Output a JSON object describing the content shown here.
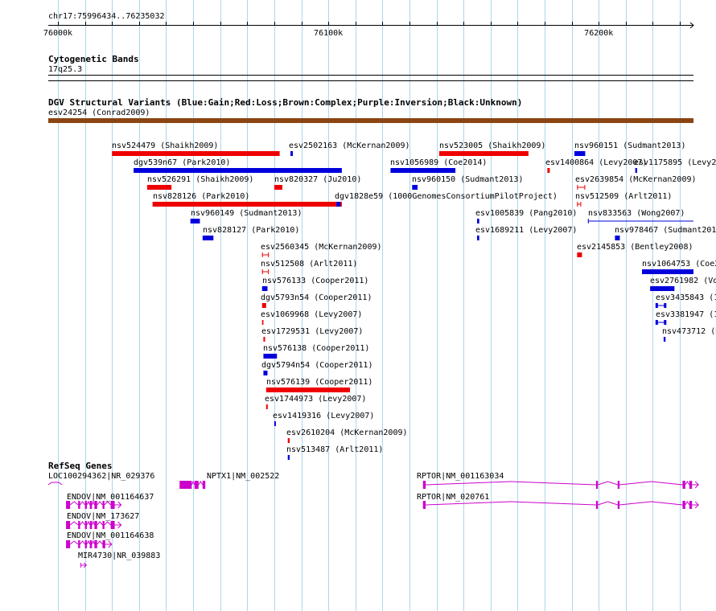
{
  "ruler": {
    "position_label": "chr17:75996434..76235032",
    "start": 75996434,
    "end": 76235032,
    "ticks": [
      {
        "label": "76000k",
        "pos": 76000000
      },
      {
        "label": "76100k",
        "pos": 76100000
      },
      {
        "label": "76200k",
        "pos": 76200000
      }
    ]
  },
  "tracks": {
    "cytoband": {
      "title": "Cytogenetic Bands",
      "band_label": "17q25.3"
    },
    "dgv": {
      "title": "DGV Structural Variants (Blue:Gain;Red:Loss;Brown:Complex;Purple:Inversion;Black:Unknown)",
      "colors": {
        "gain": "#0000dd",
        "loss": "#ee0000",
        "complex": "#8b4513",
        "inversion": "#800080",
        "unknown": "#000000"
      },
      "features": [
        {
          "label": "esv24254 (Conrad2009)",
          "type": "complex",
          "start": 75996434,
          "end": 76235032,
          "row": 0
        },
        {
          "label": "nsv524479 (Shaikh2009)",
          "type": "loss",
          "start": 76020000,
          "end": 76082000,
          "row": 1
        },
        {
          "label": "esv2502163 (McKernan2009)",
          "type": "gain",
          "start": 76086000,
          "end": 76086900,
          "row": 1
        },
        {
          "label": "nsv523005 (Shaikh2009)",
          "type": "loss",
          "start": 76141000,
          "end": 76174000,
          "row": 1
        },
        {
          "label": "nsv960151 (Sudmant2013)",
          "type": "gain",
          "start": 76191000,
          "end": 76195000,
          "row": 1
        },
        {
          "label": "dgv539n67 (Park2010)",
          "type": "gain",
          "start": 76028000,
          "end": 76105000,
          "row": 2
        },
        {
          "label": "nsv1056989 (Coe2014)",
          "type": "gain",
          "start": 76123000,
          "end": 76147000,
          "row": 2
        },
        {
          "label": "esv1400864 (Levy2007)",
          "type": "loss",
          "start": 76181000,
          "end": 76181900,
          "row": 2
        },
        {
          "label": "esv1175895 (Levy2007)",
          "type": "gain",
          "start": 76213500,
          "end": 76214200,
          "row": 2
        },
        {
          "label": "nsv526291 (Shaikh2009)",
          "type": "loss",
          "start": 76033000,
          "end": 76042000,
          "row": 3
        },
        {
          "label": "nsv820327 (Ju2010)",
          "type": "loss",
          "start": 76080000,
          "end": 76083000,
          "row": 3
        },
        {
          "label": "nsv960150 (Sudmant2013)",
          "type": "gain",
          "start": 76131000,
          "end": 76133000,
          "row": 3
        },
        {
          "label": "esv2639854 (McKernan2009)",
          "type": "loss",
          "start": 76192000,
          "end": 76195000,
          "row": 3,
          "style": "bracket"
        },
        {
          "label": "nsv828126 (Park2010)",
          "type": "loss",
          "start": 76035000,
          "end": 76105000,
          "row": 4
        },
        {
          "label": "dgv1828e59 (1000GenomesConsortiumPilotProject)",
          "type": "gain",
          "start": 76103000,
          "end": 76104500,
          "row": 4
        },
        {
          "label": "nsv512509 (Arlt2011)",
          "type": "loss",
          "start": 76192000,
          "end": 76193500,
          "row": 4,
          "style": "bracket"
        },
        {
          "label": "nsv960149 (Sudmant2013)",
          "type": "gain",
          "start": 76049000,
          "end": 76052500,
          "row": 5
        },
        {
          "label": "esv1005839 (Pang2010)",
          "type": "gain",
          "start": 76155000,
          "end": 76155800,
          "row": 5
        },
        {
          "label": "nsv833563 (Wong2007)",
          "type": "gain",
          "start": 76196000,
          "end": 76236000,
          "row": 5,
          "style": "line"
        },
        {
          "label": "nsv828127 (Park2010)",
          "type": "gain",
          "start": 76053500,
          "end": 76057500,
          "row": 6
        },
        {
          "label": "esv1689211 (Levy2007)",
          "type": "gain",
          "start": 76155000,
          "end": 76155800,
          "row": 6
        },
        {
          "label": "nsv978467 (Sudmant2013)",
          "type": "gain",
          "start": 76206000,
          "end": 76207800,
          "row": 6
        },
        {
          "label": "esv2560345 (McKernan2009)",
          "type": "loss",
          "start": 76075500,
          "end": 76078000,
          "row": 7,
          "style": "bracket"
        },
        {
          "label": "esv2145853 (Bentley2008)",
          "type": "loss",
          "start": 76192000,
          "end": 76193800,
          "row": 7
        },
        {
          "label": "nsv512508 (Arlt2011)",
          "type": "loss",
          "start": 76075500,
          "end": 76078000,
          "row": 8,
          "style": "bracket"
        },
        {
          "label": "nsv1064753 (Coe2014)",
          "type": "gain",
          "start": 76216000,
          "end": 76236000,
          "row": 8
        },
        {
          "label": "nsv576133 (Cooper2011)",
          "type": "gain",
          "start": 76075500,
          "end": 76077500,
          "row": 9
        },
        {
          "label": "esv2761982 (Vogler2010)",
          "type": "gain",
          "start": 76219000,
          "end": 76228000,
          "row": 9
        },
        {
          "label": "dgv5793n54 (Cooper2011)",
          "type": "loss",
          "start": 76075500,
          "end": 76077000,
          "row": 10
        },
        {
          "label": "esv3435843 (1000Genomes)",
          "type": "gain",
          "start": 76221000,
          "end": 76225000,
          "row": 10,
          "style": "exon"
        },
        {
          "label": "esv1069968 (Levy2007)",
          "type": "loss",
          "start": 76075500,
          "end": 76076000,
          "row": 11
        },
        {
          "label": "esv3381947 (1000Genomes)",
          "type": "gain",
          "start": 76221000,
          "end": 76225000,
          "row": 11,
          "style": "exon"
        },
        {
          "label": "esv1729531 (Levy2007)",
          "type": "loss",
          "start": 76076000,
          "end": 76076600,
          "row": 12
        },
        {
          "label": "nsv473712 (Kidd2008)",
          "type": "gain",
          "start": 76224000,
          "end": 76224700,
          "row": 12
        },
        {
          "label": "nsv576138 (Cooper2011)",
          "type": "gain",
          "start": 76076000,
          "end": 76081000,
          "row": 13
        },
        {
          "label": "dgv5794n54 (Cooper2011)",
          "type": "gain",
          "start": 76076000,
          "end": 76077500,
          "row": 14
        },
        {
          "label": "nsv576139 (Cooper2011)",
          "type": "loss",
          "start": 76077000,
          "end": 76108000,
          "row": 15
        },
        {
          "label": "esv1744973 (Levy2007)",
          "type": "loss",
          "start": 76077000,
          "end": 76077600,
          "row": 16
        },
        {
          "label": "esv1419316 (Levy2007)",
          "type": "gain",
          "start": 76080000,
          "end": 76080600,
          "row": 17
        },
        {
          "label": "esv2610204 (McKernan2009)",
          "type": "loss",
          "start": 76085000,
          "end": 76085700,
          "row": 18
        },
        {
          "label": "nsv513487 (Arlt2011)",
          "type": "gain",
          "start": 76085000,
          "end": 76085700,
          "row": 19
        }
      ]
    },
    "refseq": {
      "title": "RefSeq Genes",
      "color": "#cc00cc",
      "genes": [
        {
          "label": "LOC100294362|NR_029376",
          "start": 75996434,
          "end": 76001500,
          "strand": "-",
          "row": 0,
          "exons": []
        },
        {
          "label": "NPTX1|NM_002522",
          "start": 76045000,
          "end": 76054500,
          "strand": "-",
          "row": 0,
          "exons": [
            [
              76045000,
              76049500
            ],
            [
              76050500,
              76052000
            ],
            [
              76053500,
              76054500
            ]
          ]
        },
        {
          "label": "RPTOR|NM_001163034",
          "start": 76135000,
          "end": 76235000,
          "strand": "+",
          "row": 0,
          "exons": [
            [
              76135000,
              76136000
            ],
            [
              76199000,
              76199700
            ],
            [
              76207000,
              76207700
            ],
            [
              76231000,
              76232000
            ],
            [
              76233500,
              76234500
            ]
          ]
        },
        {
          "label": "RPTOR|NM_020761",
          "start": 76135000,
          "end": 76235000,
          "strand": "+",
          "row": 1,
          "exons": [
            [
              76135000,
              76136000
            ],
            [
              76199000,
              76199700
            ],
            [
              76207000,
              76207700
            ],
            [
              76231000,
              76232000
            ],
            [
              76233500,
              76234500
            ]
          ]
        },
        {
          "label": "ENDOV|NM_001164637",
          "start": 76003000,
          "end": 76021000,
          "strand": "+",
          "row": 1,
          "exons": [
            [
              76003000,
              76004500
            ],
            [
              76007500,
              76008200
            ],
            [
              76010000,
              76010700
            ],
            [
              76011800,
              76012600
            ],
            [
              76013500,
              76014500
            ],
            [
              76016500,
              76017200
            ],
            [
              76019500,
              76021000
            ]
          ]
        },
        {
          "label": "ENDOV|NM_173627",
          "start": 76003000,
          "end": 76021000,
          "strand": "+",
          "row": 2,
          "exons": [
            [
              76003000,
              76004500
            ],
            [
              76007500,
              76008200
            ],
            [
              76010000,
              76010700
            ],
            [
              76011800,
              76012600
            ],
            [
              76013500,
              76014500
            ],
            [
              76016500,
              76017200
            ],
            [
              76019500,
              76021000
            ]
          ]
        },
        {
          "label": "ENDOV|NM_001164638",
          "start": 76003000,
          "end": 76017500,
          "strand": "+",
          "row": 3,
          "exons": [
            [
              76003000,
              76004500
            ],
            [
              76007500,
              76008200
            ],
            [
              76010000,
              76010700
            ],
            [
              76011800,
              76012600
            ],
            [
              76013500,
              76014500
            ],
            [
              76016500,
              76017500
            ]
          ]
        },
        {
          "label": "MIR4730|NR_039883",
          "start": 76008500,
          "end": 76010500,
          "strand": "+",
          "row": 4,
          "exons": []
        }
      ]
    }
  }
}
